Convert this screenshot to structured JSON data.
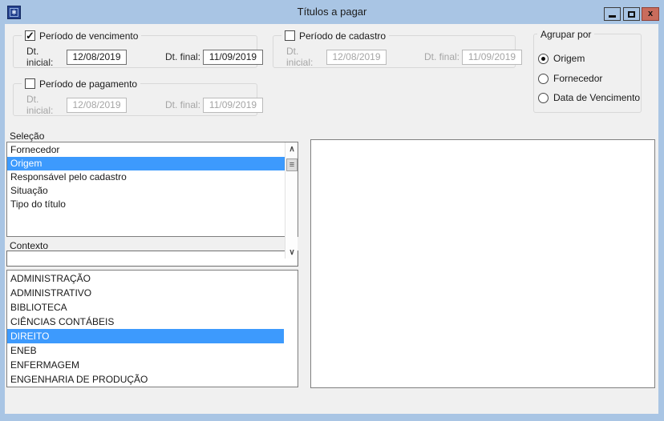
{
  "window": {
    "title": "Títulos a pagar"
  },
  "titlebar": {
    "icons": [
      "app-icon",
      "minimize-icon",
      "maximize-icon",
      "close-icon"
    ],
    "close_glyph": "x",
    "app_glyph": "✱"
  },
  "colors": {
    "titlebar": "#a9c5e4",
    "client": "#f0f0f0",
    "selection": "#3d9afd",
    "close_button": "#c96c5c"
  },
  "filters": {
    "vencimento": {
      "label": "Período de vencimento",
      "checked": true,
      "enabled": true,
      "fields": [
        {
          "label": "Dt. inicial:",
          "value": "12/08/2019"
        },
        {
          "label": "Dt. final:",
          "value": "11/09/2019"
        }
      ]
    },
    "cadastro": {
      "label": "Período de cadastro",
      "checked": false,
      "enabled": false,
      "fields": [
        {
          "label": "Dt. inicial:",
          "value": "12/08/2019"
        },
        {
          "label": "Dt. final:",
          "value": "11/09/2019"
        }
      ]
    },
    "pagamento": {
      "label": "Período de pagamento",
      "checked": false,
      "enabled": false,
      "fields": [
        {
          "label": "Dt. inicial:",
          "value": "12/08/2019"
        },
        {
          "label": "Dt. final:",
          "value": "11/09/2019"
        }
      ]
    }
  },
  "agrupar": {
    "label": "Agrupar por",
    "options": [
      {
        "label": "Origem",
        "selected": true
      },
      {
        "label": "Fornecedor",
        "selected": false
      },
      {
        "label": "Data de Vencimento",
        "selected": false
      }
    ]
  },
  "selecao": {
    "label": "Seleção",
    "items": [
      {
        "label": "Fornecedor",
        "selected": false
      },
      {
        "label": "Origem",
        "selected": true
      },
      {
        "label": "Responsável pelo cadastro",
        "selected": false
      },
      {
        "label": "Situação",
        "selected": false
      },
      {
        "label": "Tipo do título",
        "selected": false
      }
    ]
  },
  "contexto": {
    "label": "Contexto",
    "value": "",
    "items": [
      {
        "label": "ADMINISTRAÇÃO",
        "selected": false
      },
      {
        "label": "ADMINISTRATIVO",
        "selected": false
      },
      {
        "label": "BIBLIOTECA",
        "selected": false
      },
      {
        "label": "CIÊNCIAS CONTÁBEIS",
        "selected": false
      },
      {
        "label": "DIREITO",
        "selected": true
      },
      {
        "label": "ENEB",
        "selected": false
      },
      {
        "label": "ENFERMAGEM",
        "selected": false
      },
      {
        "label": "ENGENHARIA DE PRODUÇÃO",
        "selected": false
      }
    ]
  }
}
